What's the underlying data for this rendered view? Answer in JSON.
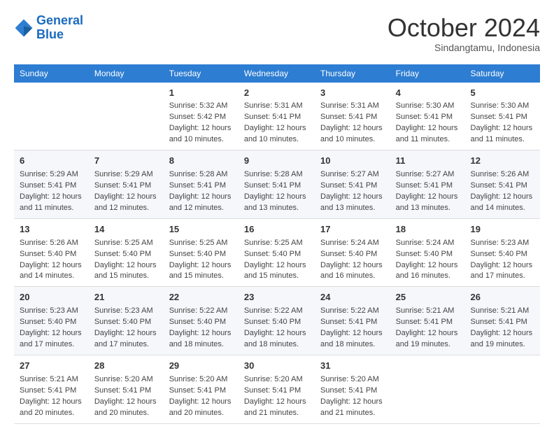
{
  "header": {
    "logo_line1": "General",
    "logo_line2": "Blue",
    "month": "October 2024",
    "location": "Sindangtamu, Indonesia"
  },
  "weekdays": [
    "Sunday",
    "Monday",
    "Tuesday",
    "Wednesday",
    "Thursday",
    "Friday",
    "Saturday"
  ],
  "weeks": [
    [
      {
        "day": "",
        "sunrise": "",
        "sunset": "",
        "daylight": ""
      },
      {
        "day": "",
        "sunrise": "",
        "sunset": "",
        "daylight": ""
      },
      {
        "day": "1",
        "sunrise": "Sunrise: 5:32 AM",
        "sunset": "Sunset: 5:42 PM",
        "daylight": "Daylight: 12 hours and 10 minutes."
      },
      {
        "day": "2",
        "sunrise": "Sunrise: 5:31 AM",
        "sunset": "Sunset: 5:41 PM",
        "daylight": "Daylight: 12 hours and 10 minutes."
      },
      {
        "day": "3",
        "sunrise": "Sunrise: 5:31 AM",
        "sunset": "Sunset: 5:41 PM",
        "daylight": "Daylight: 12 hours and 10 minutes."
      },
      {
        "day": "4",
        "sunrise": "Sunrise: 5:30 AM",
        "sunset": "Sunset: 5:41 PM",
        "daylight": "Daylight: 12 hours and 11 minutes."
      },
      {
        "day": "5",
        "sunrise": "Sunrise: 5:30 AM",
        "sunset": "Sunset: 5:41 PM",
        "daylight": "Daylight: 12 hours and 11 minutes."
      }
    ],
    [
      {
        "day": "6",
        "sunrise": "Sunrise: 5:29 AM",
        "sunset": "Sunset: 5:41 PM",
        "daylight": "Daylight: 12 hours and 11 minutes."
      },
      {
        "day": "7",
        "sunrise": "Sunrise: 5:29 AM",
        "sunset": "Sunset: 5:41 PM",
        "daylight": "Daylight: 12 hours and 12 minutes."
      },
      {
        "day": "8",
        "sunrise": "Sunrise: 5:28 AM",
        "sunset": "Sunset: 5:41 PM",
        "daylight": "Daylight: 12 hours and 12 minutes."
      },
      {
        "day": "9",
        "sunrise": "Sunrise: 5:28 AM",
        "sunset": "Sunset: 5:41 PM",
        "daylight": "Daylight: 12 hours and 13 minutes."
      },
      {
        "day": "10",
        "sunrise": "Sunrise: 5:27 AM",
        "sunset": "Sunset: 5:41 PM",
        "daylight": "Daylight: 12 hours and 13 minutes."
      },
      {
        "day": "11",
        "sunrise": "Sunrise: 5:27 AM",
        "sunset": "Sunset: 5:41 PM",
        "daylight": "Daylight: 12 hours and 13 minutes."
      },
      {
        "day": "12",
        "sunrise": "Sunrise: 5:26 AM",
        "sunset": "Sunset: 5:41 PM",
        "daylight": "Daylight: 12 hours and 14 minutes."
      }
    ],
    [
      {
        "day": "13",
        "sunrise": "Sunrise: 5:26 AM",
        "sunset": "Sunset: 5:40 PM",
        "daylight": "Daylight: 12 hours and 14 minutes."
      },
      {
        "day": "14",
        "sunrise": "Sunrise: 5:25 AM",
        "sunset": "Sunset: 5:40 PM",
        "daylight": "Daylight: 12 hours and 15 minutes."
      },
      {
        "day": "15",
        "sunrise": "Sunrise: 5:25 AM",
        "sunset": "Sunset: 5:40 PM",
        "daylight": "Daylight: 12 hours and 15 minutes."
      },
      {
        "day": "16",
        "sunrise": "Sunrise: 5:25 AM",
        "sunset": "Sunset: 5:40 PM",
        "daylight": "Daylight: 12 hours and 15 minutes."
      },
      {
        "day": "17",
        "sunrise": "Sunrise: 5:24 AM",
        "sunset": "Sunset: 5:40 PM",
        "daylight": "Daylight: 12 hours and 16 minutes."
      },
      {
        "day": "18",
        "sunrise": "Sunrise: 5:24 AM",
        "sunset": "Sunset: 5:40 PM",
        "daylight": "Daylight: 12 hours and 16 minutes."
      },
      {
        "day": "19",
        "sunrise": "Sunrise: 5:23 AM",
        "sunset": "Sunset: 5:40 PM",
        "daylight": "Daylight: 12 hours and 17 minutes."
      }
    ],
    [
      {
        "day": "20",
        "sunrise": "Sunrise: 5:23 AM",
        "sunset": "Sunset: 5:40 PM",
        "daylight": "Daylight: 12 hours and 17 minutes."
      },
      {
        "day": "21",
        "sunrise": "Sunrise: 5:23 AM",
        "sunset": "Sunset: 5:40 PM",
        "daylight": "Daylight: 12 hours and 17 minutes."
      },
      {
        "day": "22",
        "sunrise": "Sunrise: 5:22 AM",
        "sunset": "Sunset: 5:40 PM",
        "daylight": "Daylight: 12 hours and 18 minutes."
      },
      {
        "day": "23",
        "sunrise": "Sunrise: 5:22 AM",
        "sunset": "Sunset: 5:40 PM",
        "daylight": "Daylight: 12 hours and 18 minutes."
      },
      {
        "day": "24",
        "sunrise": "Sunrise: 5:22 AM",
        "sunset": "Sunset: 5:41 PM",
        "daylight": "Daylight: 12 hours and 18 minutes."
      },
      {
        "day": "25",
        "sunrise": "Sunrise: 5:21 AM",
        "sunset": "Sunset: 5:41 PM",
        "daylight": "Daylight: 12 hours and 19 minutes."
      },
      {
        "day": "26",
        "sunrise": "Sunrise: 5:21 AM",
        "sunset": "Sunset: 5:41 PM",
        "daylight": "Daylight: 12 hours and 19 minutes."
      }
    ],
    [
      {
        "day": "27",
        "sunrise": "Sunrise: 5:21 AM",
        "sunset": "Sunset: 5:41 PM",
        "daylight": "Daylight: 12 hours and 20 minutes."
      },
      {
        "day": "28",
        "sunrise": "Sunrise: 5:20 AM",
        "sunset": "Sunset: 5:41 PM",
        "daylight": "Daylight: 12 hours and 20 minutes."
      },
      {
        "day": "29",
        "sunrise": "Sunrise: 5:20 AM",
        "sunset": "Sunset: 5:41 PM",
        "daylight": "Daylight: 12 hours and 20 minutes."
      },
      {
        "day": "30",
        "sunrise": "Sunrise: 5:20 AM",
        "sunset": "Sunset: 5:41 PM",
        "daylight": "Daylight: 12 hours and 21 minutes."
      },
      {
        "day": "31",
        "sunrise": "Sunrise: 5:20 AM",
        "sunset": "Sunset: 5:41 PM",
        "daylight": "Daylight: 12 hours and 21 minutes."
      },
      {
        "day": "",
        "sunrise": "",
        "sunset": "",
        "daylight": ""
      },
      {
        "day": "",
        "sunrise": "",
        "sunset": "",
        "daylight": ""
      }
    ]
  ]
}
